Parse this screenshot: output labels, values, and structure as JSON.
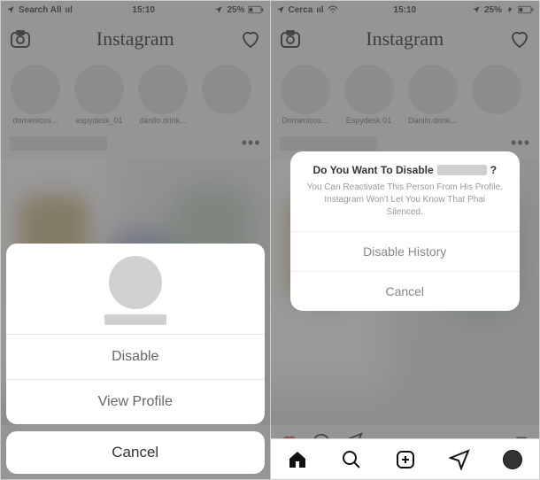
{
  "left": {
    "status": {
      "carrier": "Search All",
      "signal": "ııl",
      "time": "15:10",
      "batt": "25%"
    },
    "logo": "Instagram",
    "stories": [
      {
        "label": "domenicos..."
      },
      {
        "label": "espydesk_01"
      },
      {
        "label": "danilo.drink..."
      },
      {
        "label": ""
      },
      {
        "label": ""
      }
    ],
    "dots": "•••",
    "sheet": {
      "disable": "Disable",
      "view": "View Profile",
      "cancel": "Cancel"
    }
  },
  "right": {
    "status": {
      "carrier": "Cerca",
      "signal": "ııl",
      "time": "15:10",
      "batt": "25%"
    },
    "logo": "Instagram",
    "stories": [
      {
        "label": "Domenicos..."
      },
      {
        "label": "Espydesk 01"
      },
      {
        "label": "Danilo.drink..."
      },
      {
        "label": ""
      },
      {
        "label": ""
      }
    ],
    "dots": "•••",
    "modal": {
      "title_prefix": "Do You Want To Disable",
      "title_suffix": "?",
      "desc": "You Can Reactivate This Person From His Profile. Instagram Won't Let You Know That Phai Silenced.",
      "disable_history": "Disable History",
      "cancel": "Cancel"
    }
  }
}
